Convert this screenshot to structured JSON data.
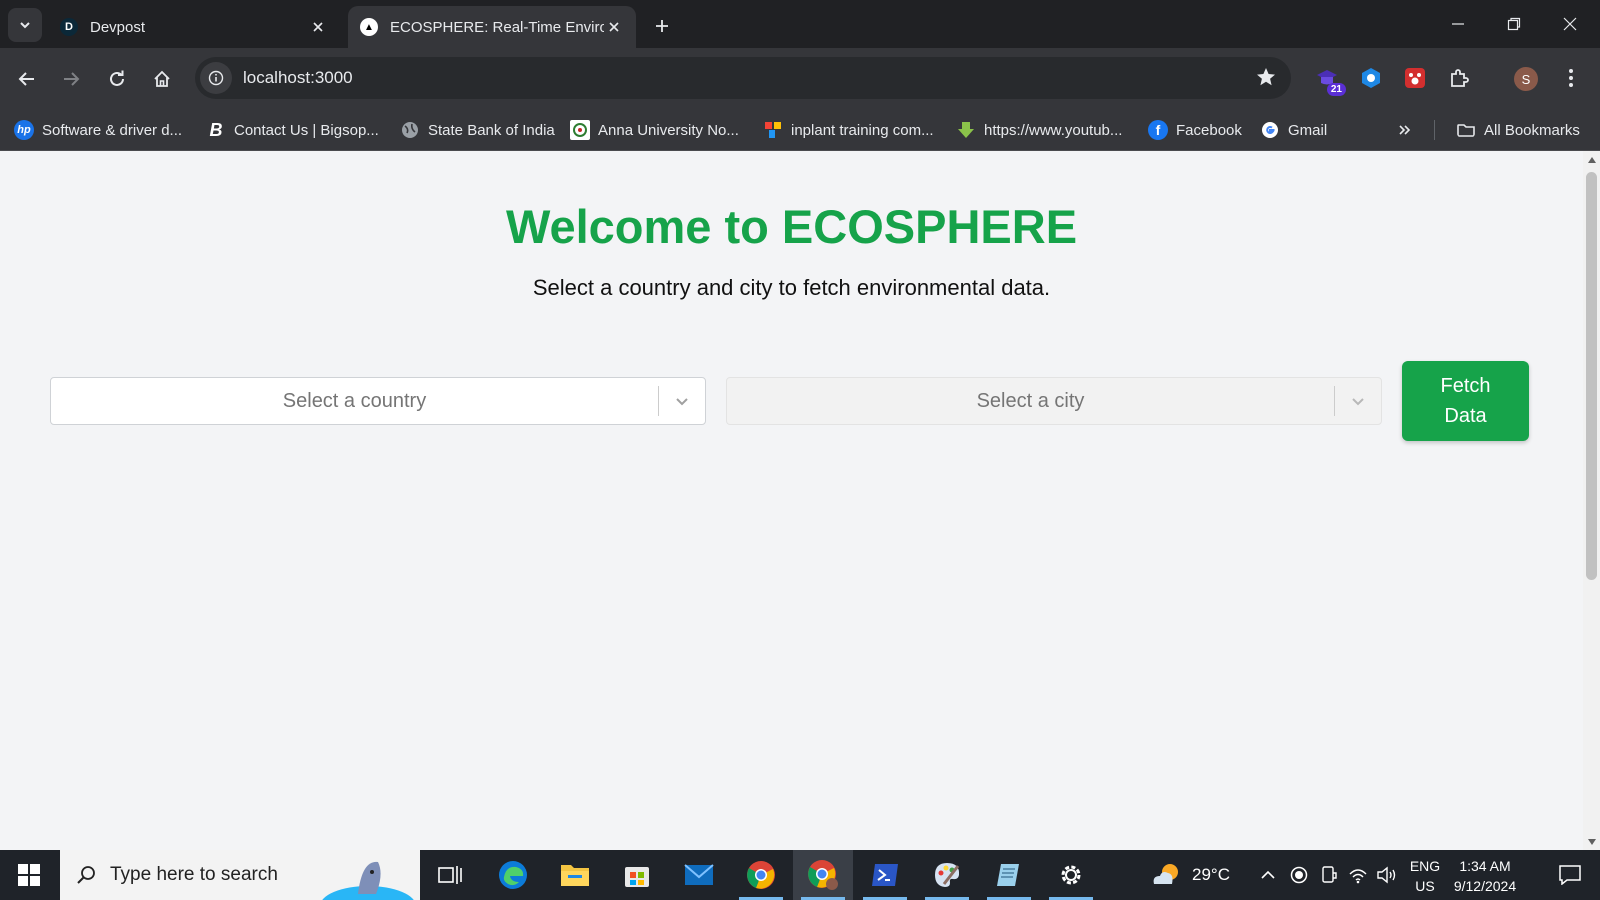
{
  "browser": {
    "tabs": [
      {
        "favicon": "D",
        "title": "Devpost"
      },
      {
        "favicon": "▲",
        "title": "ECOSPHERE: Real-Time Environmental"
      }
    ],
    "url": "localhost:3000",
    "extension_badge": "21",
    "profile_initial": "S",
    "bookmarks": [
      {
        "label": "Software & driver d..."
      },
      {
        "label": "Contact Us | Bigsop...",
        "icon_text": "B"
      },
      {
        "label": "State Bank of India"
      },
      {
        "label": "Anna University No..."
      },
      {
        "label": "inplant training com..."
      },
      {
        "label": "https://www.youtub..."
      },
      {
        "label": "Facebook"
      },
      {
        "label": "Gmail"
      }
    ],
    "all_bookmarks": "All Bookmarks"
  },
  "page": {
    "heading": "Welcome to ECOSPHERE",
    "subheading": "Select a country and city to fetch environmental data.",
    "country_placeholder": "Select a country",
    "city_placeholder": "Select a city",
    "fetch_button": "Fetch Data",
    "heading_color": "#16a34a"
  },
  "taskbar": {
    "search_placeholder": "Type here to search",
    "weather": "29°C",
    "lang_1": "ENG",
    "lang_2": "US",
    "time": "1:34 AM",
    "date": "9/12/2024"
  }
}
